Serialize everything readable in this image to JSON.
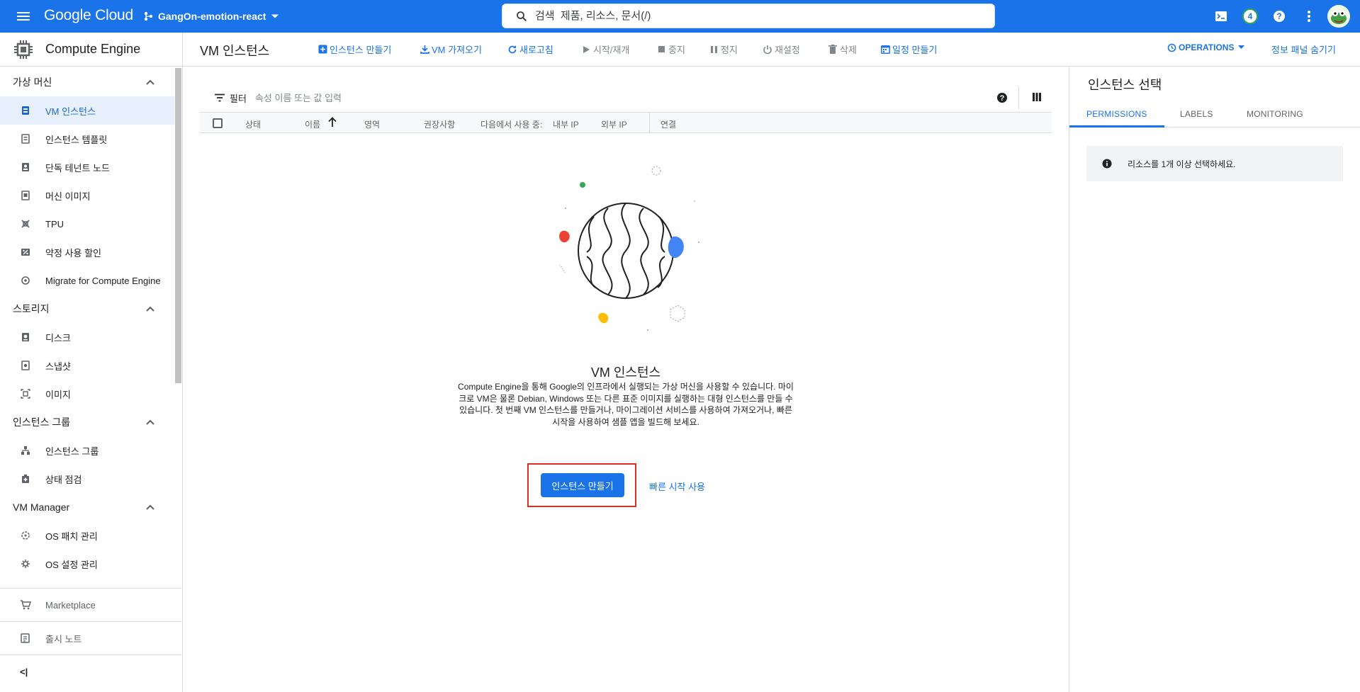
{
  "topbar": {
    "logo": "Google Cloud",
    "project": "GangOn-emotion-react",
    "search_placeholder": "검색  제품, 리소스, 문서(/)",
    "notification_count": "4"
  },
  "sidebar": {
    "product": "Compute Engine",
    "sections": [
      {
        "label": "가상 머신",
        "items": [
          "VM 인스턴스",
          "인스턴스 템플릿",
          "단독 테넌트 노드",
          "머신 이미지",
          "TPU",
          "약정 사용 할인",
          "Migrate for Compute Engine"
        ]
      },
      {
        "label": "스토리지",
        "items": [
          "디스크",
          "스냅샷",
          "이미지"
        ]
      },
      {
        "label": "인스턴스 그룹",
        "items": [
          "인스턴스 그룹",
          "상태 점검"
        ]
      },
      {
        "label": "VM Manager",
        "items": [
          "OS 패치 관리",
          "OS 설정 관리"
        ]
      }
    ],
    "marketplace": "Marketplace",
    "release_notes": "출시 노트",
    "collapse": "<|"
  },
  "actionbar": {
    "title": "VM 인스턴스",
    "create": "인스턴스 만들기",
    "import_vm": "VM 가져오기",
    "refresh": "새로고침",
    "start": "시작/재개",
    "stop": "중지",
    "suspend": "정지",
    "reset": "재설정",
    "delete": "삭제",
    "schedule": "일정 만들기",
    "operations": "OPERATIONS",
    "hide_panel": "정보 패널 숨기기"
  },
  "filter": {
    "label": "필터",
    "placeholder": "속성 이름 또는 값 입력"
  },
  "table": {
    "columns": [
      "상태",
      "이름",
      "영역",
      "권장사항",
      "다음에서 사용 중:",
      "내부 IP",
      "외부 IP",
      "연결"
    ]
  },
  "empty_state": {
    "title": "VM 인스턴스",
    "description": "Compute Engine을 통해 Google의 인프라에서 실행되는 가상 머신을 사용할 수 있습니다. 마이크로 VM은 물론 Debian, Windows 또는 다른 표준 이미지를 실행하는 대형 인스턴스를 만들 수 있습니다. 첫 번째 VM 인스턴스를 만들거나, 마이그레이션 서비스를 사용하여 가져오거나, 빠른 시작을 사용하여 샘플 앱을 빌드해 보세요.",
    "create_button": "인스턴스 만들기",
    "quickstart_link": "빠른 시작 사용"
  },
  "info_panel": {
    "title": "인스턴스 선택",
    "tabs": [
      "PERMISSIONS",
      "LABELS",
      "MONITORING"
    ],
    "message": "리소스를 1개 이상 선택하세요."
  },
  "colors": {
    "brand": "#1a73e8",
    "highlight": "#d93025"
  }
}
